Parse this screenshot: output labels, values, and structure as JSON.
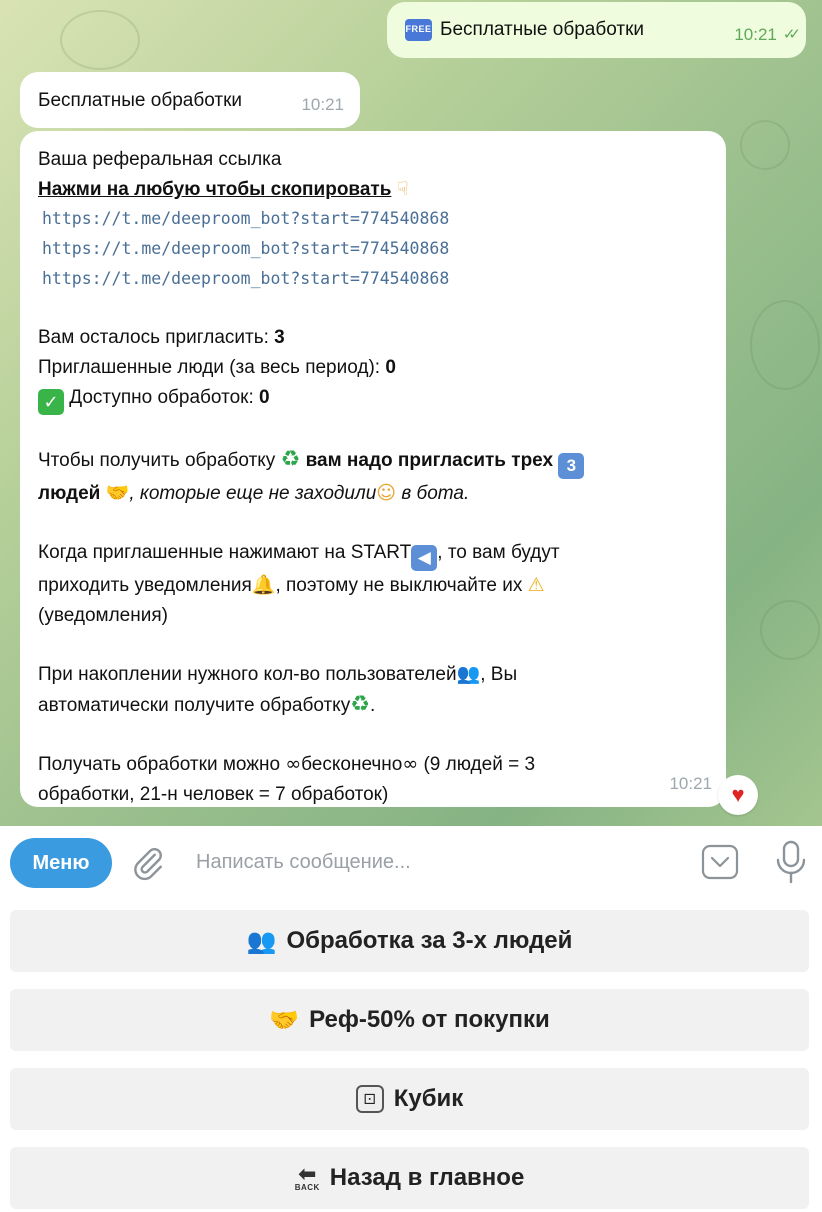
{
  "chat": {
    "outgoing": {
      "badge": "FREE",
      "text": "Бесплатные обработки",
      "time": "10:21"
    },
    "incoming_short": {
      "text": "Бесплатные обработки",
      "time": "10:21"
    },
    "incoming_long": {
      "line1": "Ваша реферальная ссылка",
      "line2": "Нажми на любую чтобы скопировать",
      "links": [
        "https://t.me/deeproom_bot?start=774540868",
        "https://t.me/deeproom_bot?start=774540868",
        "https://t.me/deeproom_bot?start=774540868"
      ],
      "invite_left_label": "Вам осталось пригласить: ",
      "invite_left_value": "3",
      "invited_label": "Приглашенные люди (за весь период): ",
      "invited_value": "0",
      "available_label": " Доступно обработок: ",
      "available_value": "0",
      "p1_a": "Чтобы получить обработку ",
      "p1_b": " вам надо пригласить трех ",
      "p1_c": "людей ",
      "p1_d": ", которые еще не заходили",
      "p1_e": " в бота.",
      "p2_a": "Когда приглашенные нажимают на START",
      "p2_b": ", то вам будут",
      "p2_c": "приходить уведомления",
      "p2_d": ", поэтому не выключайте их ",
      "p2_e": "(уведомления)",
      "p3_a": "При накоплении нужного кол-во пользователей",
      "p3_b": ", Вы",
      "p3_c": "автоматически получите обработку",
      "p3_d": ".",
      "p4_a": "Получать обработки можно ",
      "p4_b": "бесконечно",
      "p4_c": " (9 людей = 3",
      "p4_d": "обработки, 21-н человек = 7 обработок)",
      "time": "10:21"
    }
  },
  "input": {
    "menu_label": "Меню",
    "placeholder": "Написать сообщение..."
  },
  "keyboard": {
    "buttons": [
      "Обработка за 3-х людей",
      "Реф-50% от покупки",
      "Кубик",
      "Назад в главное"
    ]
  },
  "icons": {
    "btn1": "people-icon",
    "btn2": "handshake-icon",
    "btn3": "dice-icon",
    "btn4": "back-icon"
  },
  "colors": {
    "menu_button": "#3a9be0",
    "outgoing_bubble": "#effdde",
    "link": "#4a6f96",
    "reaction_heart": "#e02424"
  }
}
